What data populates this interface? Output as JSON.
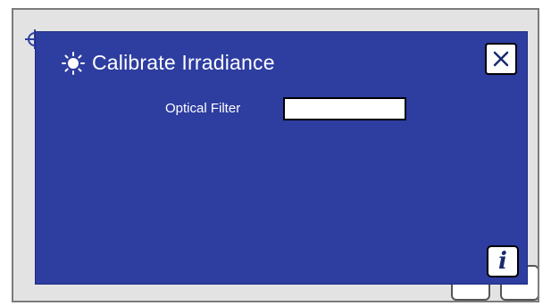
{
  "dialog": {
    "title": "Calibrate Irradiance",
    "title_icon": "sun-icon",
    "close_icon": "close-icon",
    "info_icon": "info-icon",
    "info_glyph": "i",
    "colors": {
      "background": "#2e3da0",
      "text": "#ffffff"
    }
  },
  "form": {
    "optical_filter_label": "Optical Filter",
    "optical_filter_value": ""
  },
  "background": {
    "crosshair_icon": "crosshair-icon"
  }
}
